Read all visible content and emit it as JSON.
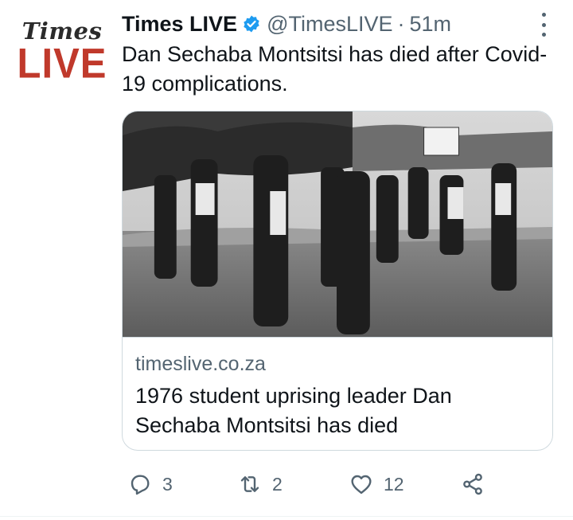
{
  "tweet": {
    "avatar": {
      "line1": "Times",
      "line2": "LIVE"
    },
    "name": "Times LIVE",
    "handle": "@TimesLIVE",
    "separator": "·",
    "time": "51m",
    "text": "Dan Sechaba Montsitsi has died after Covid-19 complications.",
    "card": {
      "domain": "timeslive.co.za",
      "title": "1976 student uprising leader Dan Sechaba Montsitsi has died"
    },
    "actions": {
      "replies": "3",
      "retweets": "2",
      "likes": "12"
    }
  },
  "colors": {
    "text": "#0f1419",
    "secondary": "#536471",
    "verified": "#1d9bf0",
    "brand_red": "#c0392b",
    "border": "#cfd9de"
  },
  "icons": [
    "verified-badge-icon",
    "more-icon",
    "reply-icon",
    "retweet-icon",
    "like-icon",
    "share-icon"
  ]
}
